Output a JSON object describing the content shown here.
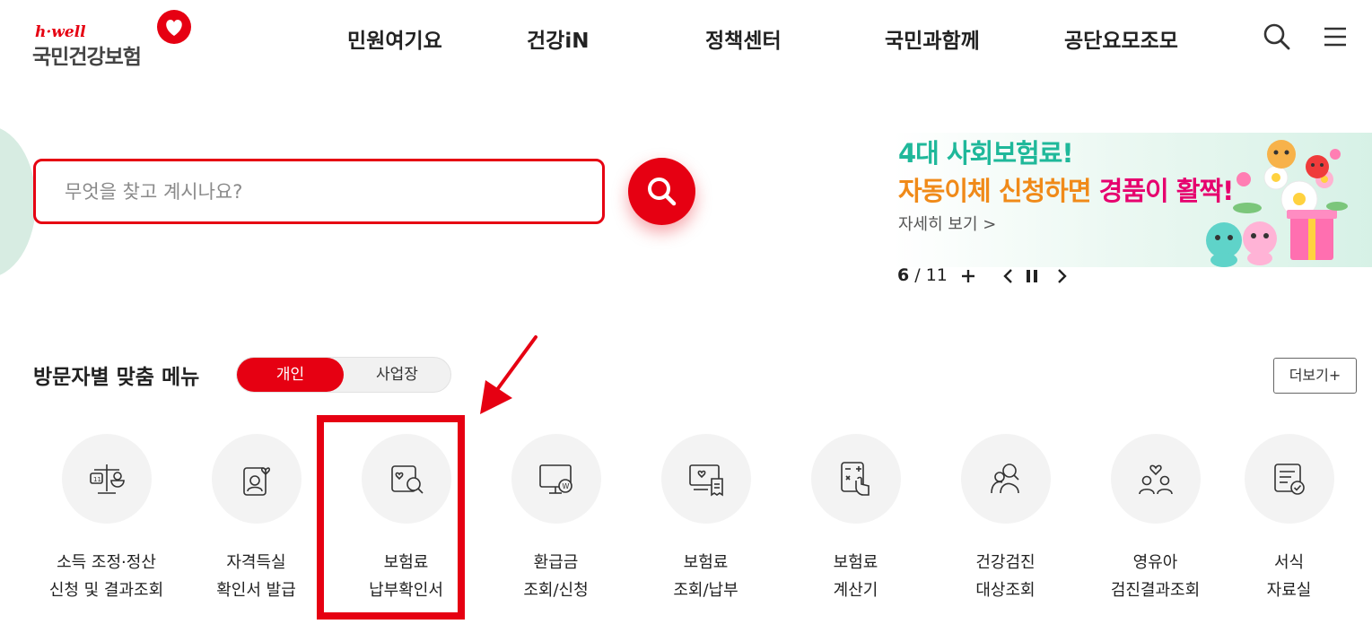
{
  "header": {
    "logo_sub": "h·well",
    "logo_main": "국민건강보험",
    "nav": [
      "민원여기요",
      "건강iN",
      "정책센터",
      "국민과함께",
      "공단요모조모"
    ],
    "icons": {
      "search": "search-icon",
      "menu": "hamburger-menu-icon"
    }
  },
  "search": {
    "placeholder": "무엇을 찾고 계시나요?",
    "value": ""
  },
  "banner": {
    "line1": "4대 사회보험료!",
    "line2_a": "자동이체 신청하면 ",
    "line2_b": "경품이 활짝!",
    "link": "자세히 보기 >",
    "current": "6",
    "total": "/ 11",
    "colors": {
      "line1": "#1fb89a",
      "line2": "#f08a19",
      "highlight": "#e6006e"
    }
  },
  "visitor": {
    "title": "방문자별 맞춤 메뉴",
    "tabs": [
      "개인",
      "사업장"
    ],
    "active_tab": "개인",
    "more": "더보기+"
  },
  "quick_menu": [
    {
      "l1": "소득 조정·정산",
      "l2": "신청 및 결과조회",
      "icon": "scale-icon"
    },
    {
      "l1": "자격득실",
      "l2": "확인서 발급",
      "icon": "id-card-heart-icon"
    },
    {
      "l1": "보험료",
      "l2": "납부확인서",
      "icon": "document-search-icon"
    },
    {
      "l1": "환급금",
      "l2": "조회/신청",
      "icon": "monitor-won-icon"
    },
    {
      "l1": "보험료",
      "l2": "조회/납부",
      "icon": "monitor-receipt-icon"
    },
    {
      "l1": "보험료",
      "l2": "계산기",
      "icon": "calculator-hand-icon"
    },
    {
      "l1": "건강검진",
      "l2": "대상조회",
      "icon": "people-search-icon"
    },
    {
      "l1": "영유아",
      "l2": "검진결과조회",
      "icon": "family-heart-icon"
    },
    {
      "l1": "서식",
      "l2": "자료실",
      "icon": "form-check-icon"
    }
  ],
  "theme": {
    "accent": "#e60012"
  }
}
